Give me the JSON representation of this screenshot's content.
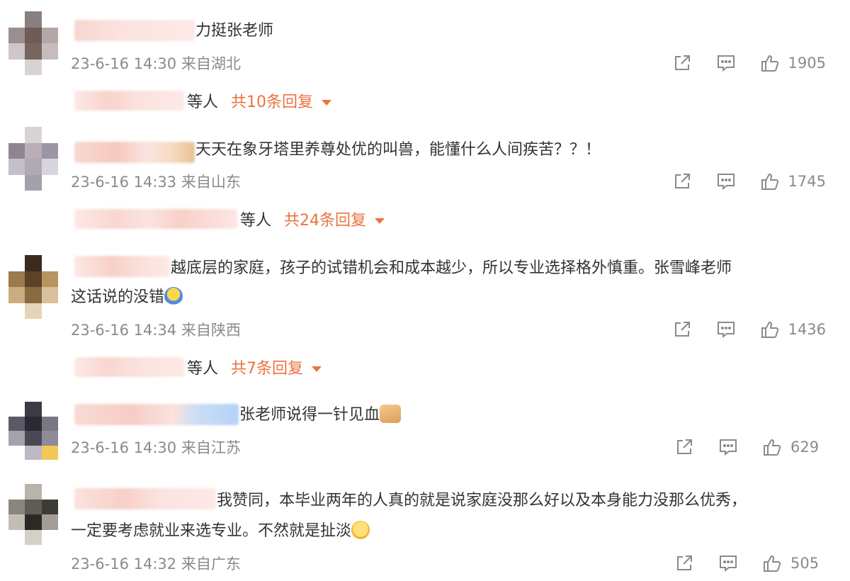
{
  "comments": [
    {
      "text_visible": "力挺张老师",
      "time": "23-6-16 14:30",
      "location": "来自湖北",
      "likes": "1905",
      "replies_prefix": "等人",
      "replies_total": "共10条回复"
    },
    {
      "text_visible": "天天在象牙塔里养尊处优的叫兽，能懂什么人间疾苦？？！",
      "time": "23-6-16 14:33",
      "location": "来自山东",
      "likes": "1745",
      "replies_prefix": "等人",
      "replies_total": "共24条回复"
    },
    {
      "text_line1": "越底层的家庭，孩子的试错机会和成本越少，所以专业选择格外慎重。张雪峰老师",
      "text_line2": "这话说的没错",
      "emoji": "hug-emoji",
      "time": "23-6-16 14:34",
      "location": "来自陕西",
      "likes": "1436",
      "replies_prefix": "等人",
      "replies_total": "共7条回复"
    },
    {
      "text_visible": "张老师说得一针见血",
      "emoji": "thumbs-up-emoji",
      "time": "23-6-16 14:30",
      "location": "来自江苏",
      "likes": "629"
    },
    {
      "text_line1": "我赞同，本毕业两年的人真的就是说家庭没那么好以及本身能力没那么优秀，",
      "text_line2": "一定要考虑就业来选专业。不然就是扯淡",
      "emoji": "laugh-emoji",
      "time": "23-6-16 14:32",
      "location": "来自广东",
      "likes": "505"
    }
  ],
  "icons": {
    "share": "share-icon",
    "reply": "comment-icon",
    "like": "thumbs-up-icon"
  },
  "colors": {
    "accent": "#eb7340",
    "meta": "#8a8a8a",
    "text": "#333333"
  }
}
